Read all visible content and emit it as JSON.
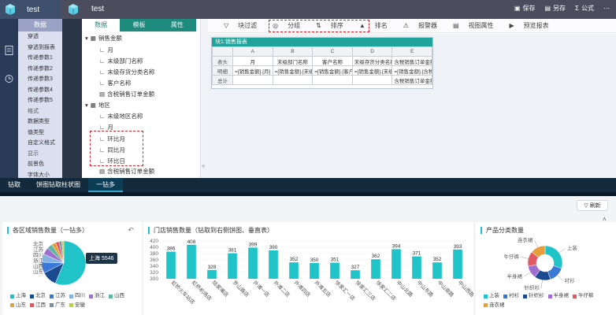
{
  "header": {
    "app_title_left": "test",
    "app_title_right": "test",
    "actions": {
      "save": "保存",
      "save_as": "另存",
      "formula": "公式"
    }
  },
  "left_panel": {
    "header": "数据",
    "rows": [
      "穿透",
      "穿透到报表",
      "传递参数1",
      "传递参数2",
      "传递参数3",
      "传递参数4",
      "传递参数5",
      "格式",
      "数据类型",
      "值类型",
      "自定义格式",
      "显示",
      "前景色",
      "字体大小"
    ]
  },
  "tabs": {
    "data": "数据",
    "template": "模板",
    "property": "属性"
  },
  "tree": {
    "sales_amount": "销售金额",
    "month": "月",
    "last_dept": "末级部门名称",
    "last_inventory_class": "末级存货分类名称",
    "customer_name": "客户名称",
    "tax_sales_amount": "含税销售订单金额",
    "region": "地区",
    "last_region": "末级地区名称",
    "month2": "月",
    "mom": "环比月",
    "yoy": "同比月",
    "dod": "环比日",
    "tax_sales_amount2": "含税销售订单金额"
  },
  "canvas_toolbar": {
    "block_filter": "块过滤",
    "group": "分组",
    "sort": "排序",
    "rank": "排名",
    "alarm": "报警器",
    "view_props": "视图属性",
    "preview": "预览报表"
  },
  "sheet": {
    "title": "块1:销售报表",
    "col_letters": [
      "A",
      "B",
      "C",
      "D",
      "E"
    ],
    "row_labels": [
      "表头",
      "明细",
      "总计"
    ],
    "header_row": [
      "月",
      "末级部门名称",
      "客户名称",
      "末级存货分类名称",
      "含税销售订单金额"
    ],
    "detail_row": [
      "=[销售金额].[月]",
      "=[销售金额].[末级",
      "=[销售金额].[客户",
      "=[销售金额].[末级",
      "=[销售金额].[含税"
    ],
    "total_row": [
      "",
      "",
      "",
      "",
      "含税销售订单金额"
    ]
  },
  "bottom_tabs": [
    "钻取",
    "饼图钻取柱状图",
    "一钻多"
  ],
  "refresh_label": "刷新",
  "colors": {
    "teal": "#1f8b7e",
    "accent": "#20c4c8",
    "dark": "#122a3b"
  },
  "chart_data": [
    {
      "type": "pie",
      "title": "各区域销售数量（一钻多）",
      "tooltip": "上海 5546",
      "slices": [
        {
          "name": "上海",
          "value": 5546,
          "color": "#20c4c8"
        },
        {
          "name": "北京",
          "value": 1100,
          "color": "#1a4a8f"
        },
        {
          "name": "江苏",
          "value": 800,
          "color": "#3a78d6"
        },
        {
          "name": "四川",
          "value": 600,
          "color": "#86b1e3"
        },
        {
          "name": "浙江",
          "value": 500,
          "color": "#9e6fd1"
        },
        {
          "name": "山西",
          "value": 400,
          "color": "#5fb6a2"
        },
        {
          "name": "山东",
          "value": 300,
          "color": "#e89f3b"
        },
        {
          "name": "江西",
          "value": 250,
          "color": "#e05a64"
        },
        {
          "name": "广东",
          "value": 200,
          "color": "#7a8ea6"
        },
        {
          "name": "安徽",
          "value": 150,
          "color": "#b7d34a"
        }
      ]
    },
    {
      "type": "bar",
      "title": "门店销售数量（钻取到右侧饼图、垂直表）",
      "categories": [
        "虹桥火车站店",
        "虹桥机场店",
        "陆家嘴店",
        "罗山路店",
        "外滩一店",
        "外滩二店",
        "外滩四店",
        "外滩五店",
        "徐家汇一店",
        "徐家汇三店",
        "徐家汇二店",
        "中山北路",
        "中山东路",
        "中山南路",
        "中山西路"
      ],
      "values": [
        386,
        408,
        328,
        381,
        399,
        390,
        352,
        350,
        351,
        327,
        362,
        394,
        371,
        352,
        393
      ],
      "ylim": [
        300,
        420
      ],
      "color": "#20c4c8"
    },
    {
      "type": "pie",
      "title": "产品分类数量",
      "donut": true,
      "slices": [
        {
          "name": "上装",
          "value": 30,
          "color": "#20c4c8"
        },
        {
          "name": "衬衫",
          "value": 15,
          "color": "#3a78d6"
        },
        {
          "name": "针织衫",
          "value": 15,
          "color": "#1a4a8f"
        },
        {
          "name": "半身裙",
          "value": 12,
          "color": "#9e6fd1"
        },
        {
          "name": "牛仔裤",
          "value": 14,
          "color": "#e05a64"
        },
        {
          "name": "连衣裙",
          "value": 14,
          "color": "#e89f3b"
        }
      ]
    }
  ]
}
